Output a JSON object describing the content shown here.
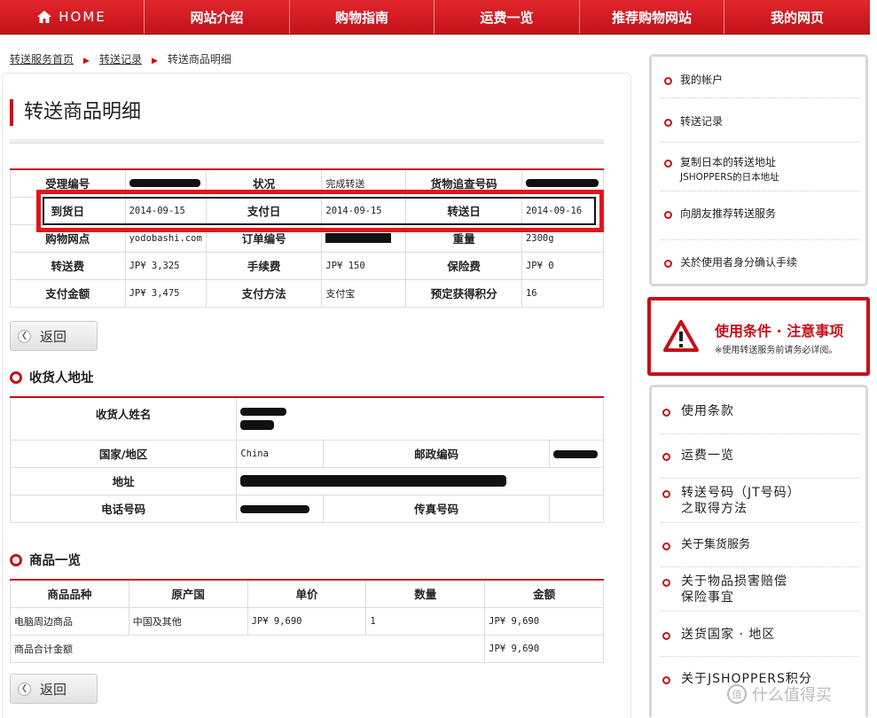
{
  "nav": {
    "home": "HOME",
    "items": [
      "网站介绍",
      "购物指南",
      "运费一览",
      "推荐购物网站",
      "我的网页"
    ]
  },
  "breadcrumb": {
    "home": "转送服务首页",
    "records": "转送记录",
    "current": "转送商品明细"
  },
  "page_title": "转送商品明细",
  "detail": {
    "receipt_no_label": "受理编号",
    "status_label": "状况",
    "status_value": "完成转送",
    "tracking_label": "货物追查号码",
    "arrival_label": "到货日",
    "arrival_value": "2014-09-15",
    "payment_date_label": "支付日",
    "payment_date_value": "2014-09-15",
    "ship_date_label": "转送日",
    "ship_date_value": "2014-09-16",
    "shop_label": "购物网点",
    "shop_value": "yodobashi.com",
    "order_no_label": "订单编号",
    "weight_label": "重量",
    "weight_value": "2300g",
    "ship_fee_label": "转送费",
    "ship_fee_value": "JP¥ 3,325",
    "handling_label": "手续费",
    "handling_value": "JP¥ 150",
    "insurance_label": "保险费",
    "insurance_value": "JP¥ 0",
    "total_label": "支付金额",
    "total_value": "JP¥ 3,475",
    "method_label": "支付方法",
    "method_value": "支付宝",
    "points_label": "预定获得积分",
    "points_value": "16"
  },
  "back_label": "返回",
  "consignee": {
    "heading": "收货人地址",
    "name_label": "收货人姓名",
    "country_label": "国家/地区",
    "country_value": "China",
    "zip_label": "邮政编码",
    "address_label": "地址",
    "phone_label": "电话号码",
    "fax_label": "传真号码"
  },
  "goods": {
    "heading": "商品一览",
    "headers": [
      "商品品种",
      "原产国",
      "单价",
      "数量",
      "金额"
    ],
    "row": [
      "电脑周边商品",
      "中国及其他",
      "JP¥ 9,690",
      "1",
      "JP¥ 9,690"
    ],
    "subtotal_label": "商品合计金额",
    "subtotal_value": "JP¥ 9,690"
  },
  "sidebar": {
    "account": [
      "我的帐户",
      "转送记录",
      "复制日本的转送地址",
      "JSHOPPERS的日本地址",
      "向朋友推荐转送服务",
      "关於使用者身分确认手续"
    ],
    "notice_title": "使用条件 · 注意事项",
    "notice_sub": "※使用转送服务前请务必详阅。",
    "links": [
      "使用条款",
      "运费一览",
      "转送号码（JT号码）",
      "之取得方法",
      "关于集货服务",
      "关于物品损害赔偿",
      "保险事宜",
      "送货国家 · 地区",
      "关于JSHOPPERS积分"
    ]
  },
  "watermark": "什么值得买",
  "colors": {
    "brand_red": "#c4121a",
    "highlight_red": "#e3141c"
  }
}
